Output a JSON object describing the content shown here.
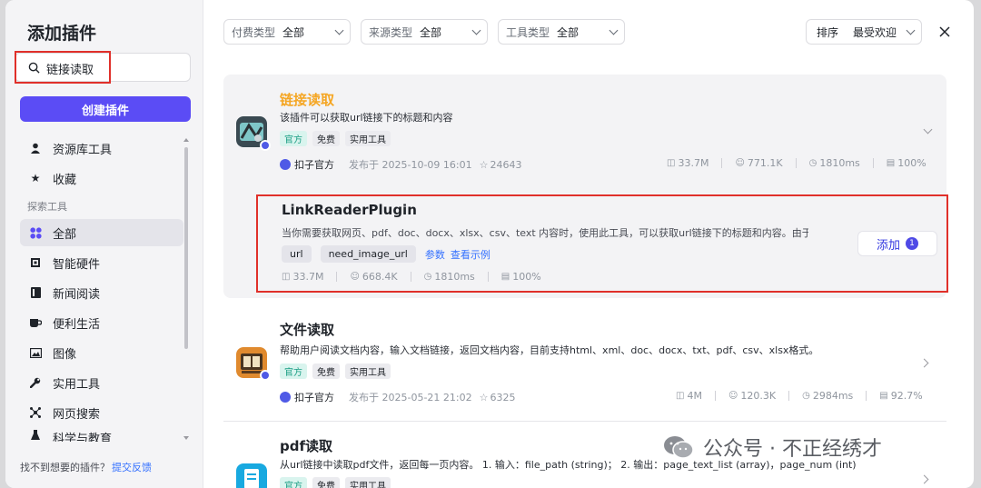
{
  "sidebar": {
    "title": "添加插件",
    "search_value": "链接读取",
    "create_button": "创建插件",
    "items_top": [
      {
        "label": "资源库工具",
        "icon": "person-icon"
      },
      {
        "label": "收藏",
        "icon": "star-icon"
      }
    ],
    "section_label": "探索工具",
    "items": [
      {
        "label": "全部",
        "icon": "grid-icon"
      },
      {
        "label": "智能硬件",
        "icon": "chip-icon"
      },
      {
        "label": "新闻阅读",
        "icon": "book-icon"
      },
      {
        "label": "便利生活",
        "icon": "cup-icon"
      },
      {
        "label": "图像",
        "icon": "image-icon"
      },
      {
        "label": "实用工具",
        "icon": "wrench-icon"
      },
      {
        "label": "网页搜索",
        "icon": "network-icon"
      },
      {
        "label": "科学与教育",
        "icon": "flask-icon"
      }
    ],
    "footer_text": "找不到想要的插件？",
    "footer_link": "提交反馈"
  },
  "header": {
    "filters": [
      {
        "label": "付费类型",
        "value": "全部"
      },
      {
        "label": "来源类型",
        "value": "全部"
      },
      {
        "label": "工具类型",
        "value": "全部"
      }
    ],
    "sort_label": "排序",
    "sort_value": "最受欢迎",
    "close_icon": "close-icon"
  },
  "plugins": [
    {
      "name": "链接读取",
      "description": "该插件可以获取url链接下的标题和内容",
      "tags": [
        "官方",
        "免费",
        "实用工具"
      ],
      "author": "扣子官方",
      "published": "发布于 2025-10-09 16:01",
      "favorites": "24643",
      "stats": {
        "calls": "33.7M",
        "users": "771.1K",
        "latency": "1810ms",
        "success": "100%"
      },
      "tool": {
        "name": "LinkReaderPlugin",
        "description": "当你需要获取网页、pdf、doc、docx、xlsx、csv、text 内容时，使用此工具，可以获取url链接下的标题和内容。由于…",
        "params": [
          "url",
          "need_image_url"
        ],
        "param_link": "参数",
        "example_link": "查看示例",
        "stats": {
          "calls": "33.7M",
          "users": "668.4K",
          "latency": "1810ms",
          "success": "100%"
        },
        "add_label": "添加",
        "add_count": "1"
      }
    },
    {
      "name": "文件读取",
      "description": "帮助用户阅读文档内容，输入文档链接，返回文档内容，目前支持html、xml、doc、docx、txt、pdf、csv、xlsx格式。",
      "tags": [
        "官方",
        "免费",
        "实用工具"
      ],
      "author": "扣子官方",
      "published": "发布于 2025-05-21 21:02",
      "favorites": "6325",
      "stats": {
        "calls": "4M",
        "users": "120.3K",
        "latency": "2984ms",
        "success": "92.7%"
      }
    },
    {
      "name": "pdf读取",
      "description": "从url链接中读取pdf文件，返回每一页内容。 1. 输入：file_path (string)； 2. 输出：page_text_list (array)，page_num (int)",
      "tags": [
        "官方",
        "免费",
        "实用工具"
      ]
    }
  ],
  "watermark": "公众号 · 不正经绣才",
  "colors": {
    "accent": "#5b4cf5",
    "highlight": "#e0302a",
    "orange_title": "#f5a623",
    "link": "#3370ff"
  }
}
